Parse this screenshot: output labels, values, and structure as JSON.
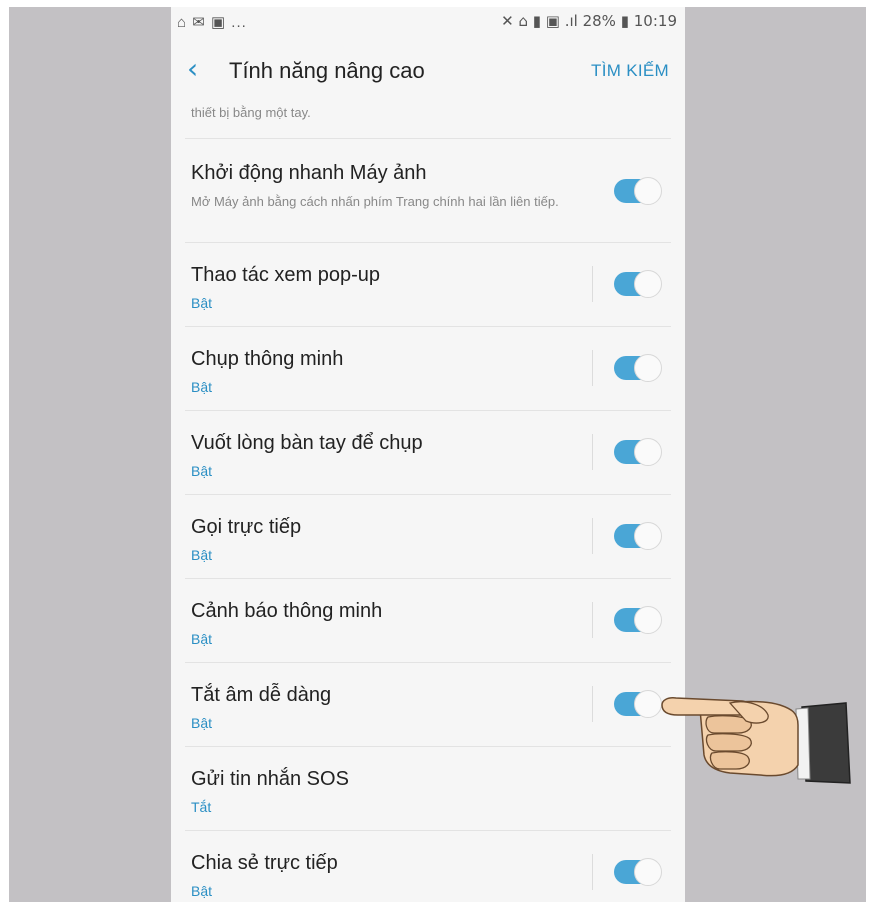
{
  "status_bar": {
    "left_icons": "⌂ ✉ ▣ ...",
    "right_icons": "✕ ⌂ ▮ ▣ .ıl",
    "battery": "28%",
    "time": "10:19"
  },
  "header": {
    "title": "Tính năng nâng cao",
    "search_label": "TÌM KIẾM"
  },
  "partial_text": "thiết bị bằng một tay.",
  "settings": [
    {
      "title": "Khởi động nhanh Máy ảnh",
      "subtitle": "Mở Máy ảnh bằng cách nhấn phím Trang chính hai lần liên tiếp.",
      "enabled": true
    },
    {
      "title": "Thao tác xem pop-up",
      "subtitle": "Bật",
      "enabled": true
    },
    {
      "title": "Chụp thông minh",
      "subtitle": "Bật",
      "enabled": true
    },
    {
      "title": "Vuốt lòng bàn tay để chụp",
      "subtitle": "Bật",
      "enabled": true
    },
    {
      "title": "Gọi trực tiếp",
      "subtitle": "Bật",
      "enabled": true
    },
    {
      "title": "Cảnh báo thông minh",
      "subtitle": "Bật",
      "enabled": true
    },
    {
      "title": "Tắt âm dễ dàng",
      "subtitle": "Bật",
      "enabled": true
    },
    {
      "title": "Gửi tin nhắn SOS",
      "subtitle": "Tắt",
      "enabled": false
    },
    {
      "title": "Chia sẻ trực tiếp",
      "subtitle": "Bật",
      "enabled": true
    }
  ],
  "colors": {
    "accent": "#2b8fc4",
    "toggle_on": "#4aa6d6",
    "background": "#f6f6f6",
    "frame": "#c3c1c4"
  },
  "overlay": {
    "icon": "pointing-hand-icon"
  }
}
